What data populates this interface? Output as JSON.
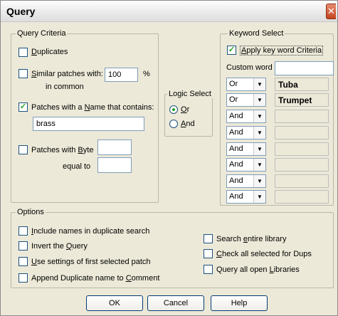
{
  "window": {
    "title": "Query",
    "close_glyph": "✕"
  },
  "query_criteria": {
    "title": "Query Criteria",
    "duplicates": {
      "pre": "",
      "key": "D",
      "post": "uplicates",
      "checked": false
    },
    "similar": {
      "pre": "",
      "key": "S",
      "post": "imilar patches with:",
      "checked": false,
      "value": "100",
      "unit": "%",
      "suffix": "in common"
    },
    "name_contains": {
      "pre": "Patches with a ",
      "key": "N",
      "post": "ame that contains:",
      "checked": true,
      "value": "brass"
    },
    "byte": {
      "pre": "Patches with ",
      "key": "B",
      "post": "yte",
      "checked": false,
      "value": "",
      "equal_label": "equal to",
      "equal_value": ""
    }
  },
  "logic_select": {
    "title": "Logic Select",
    "or": {
      "pre": "",
      "key": "O",
      "post": "r",
      "selected": true
    },
    "and": {
      "pre": "",
      "key": "A",
      "post": "nd",
      "selected": false
    }
  },
  "keyword_select": {
    "title": "Keyword Select",
    "apply": {
      "pre": "",
      "key": "A",
      "post": "pply key word Criteria",
      "checked": true
    },
    "custom_word_label": "Custom word",
    "custom_word_value": "",
    "rows": [
      {
        "logic": "Or",
        "keyword": "Tuba"
      },
      {
        "logic": "Or",
        "keyword": "Trumpet"
      },
      {
        "logic": "And",
        "keyword": ""
      },
      {
        "logic": "And",
        "keyword": ""
      },
      {
        "logic": "And",
        "keyword": ""
      },
      {
        "logic": "And",
        "keyword": ""
      },
      {
        "logic": "And",
        "keyword": ""
      },
      {
        "logic": "And",
        "keyword": ""
      }
    ]
  },
  "options": {
    "title": "Options",
    "include_names": {
      "pre": "",
      "key": "I",
      "post": "nclude names in duplicate search",
      "checked": false
    },
    "invert": {
      "pre": "Invert the ",
      "key": "Q",
      "post": "uery",
      "checked": false
    },
    "use_settings": {
      "pre": "",
      "key": "U",
      "post": "se settings of first selected patch",
      "checked": false
    },
    "append": {
      "pre": "Append Duplicate name to ",
      "key": "C",
      "post": "omment",
      "checked": false
    },
    "search_entire": {
      "pre": "Search ",
      "key": "e",
      "post": "ntire library",
      "checked": false
    },
    "check_all": {
      "pre": "",
      "key": "C",
      "post": "heck all selected for Dups",
      "checked": false
    },
    "query_all": {
      "pre": "Query all open ",
      "key": "L",
      "post": "ibraries",
      "checked": false
    }
  },
  "buttons": {
    "ok": "OK",
    "cancel": "Cancel",
    "help": "Help"
  },
  "colors": {
    "face": "#ece9d8",
    "check": "#21a121",
    "border": "#1c5180",
    "input_border": "#7f9db9"
  }
}
